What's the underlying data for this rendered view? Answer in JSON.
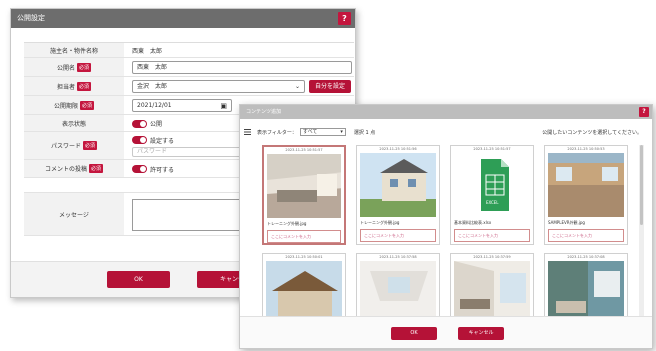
{
  "dialog1": {
    "title": "公開設定",
    "help": "?",
    "rows": {
      "owner_label": "施主名・物件名称",
      "owner_value": "西東　太郎",
      "public_name_label": "公開名",
      "public_name_value": "西東　太郎",
      "staff_label": "担当者",
      "staff_value": "金沢　太郎",
      "set_self_button": "自分を設定",
      "period_label": "公開期限",
      "period_value": "2021/12/01",
      "display_label": "表示状態",
      "display_value": "公開",
      "password_label": "パスワード",
      "password_toggle": "設定する",
      "password_placeholder": "パスワード",
      "comment_label": "コメントの投稿",
      "comment_value": "許可する",
      "message_label": "メッセージ"
    },
    "required": "必須",
    "ok": "OK",
    "cancel": "キャンセ"
  },
  "dialog2": {
    "title": "コンテンツ追加",
    "help": "?",
    "filter_label": "表示フィルター",
    "filter_value": "すべて",
    "selected": "選択 1 点",
    "hint": "公開したいコンテンツを選択してください。",
    "cards": [
      {
        "ts": "2023-11-25 10:51:57",
        "name": "トレーニング外観.jpg",
        "comment": "ここにコメントを入力"
      },
      {
        "ts": "2023-11-25 10:51:56",
        "name": "トレーニング外観.jpg",
        "comment": "ここにコメントを入力"
      },
      {
        "ts": "2023-11-25 10:51:57",
        "name": "基本資料比較表.xlsx",
        "comment": "ここにコメントを入力"
      },
      {
        "ts": "2023-11-25 10:50:53",
        "name": "SAMPLEVR外観.jpg",
        "comment": "ここにコメントを入力"
      },
      {
        "ts": "2023-11-25 10:50:01"
      },
      {
        "ts": "2023-11-25 10:37:58"
      },
      {
        "ts": "2023-11-25 10:37:59"
      },
      {
        "ts": "2023-11-25 10:37:08"
      }
    ],
    "excel_icon_label": "EXCEL",
    "ok": "OK",
    "cancel": "キャンセル"
  },
  "colors": {
    "accent": "#b51237",
    "titlebar": "#6d6d6d"
  }
}
